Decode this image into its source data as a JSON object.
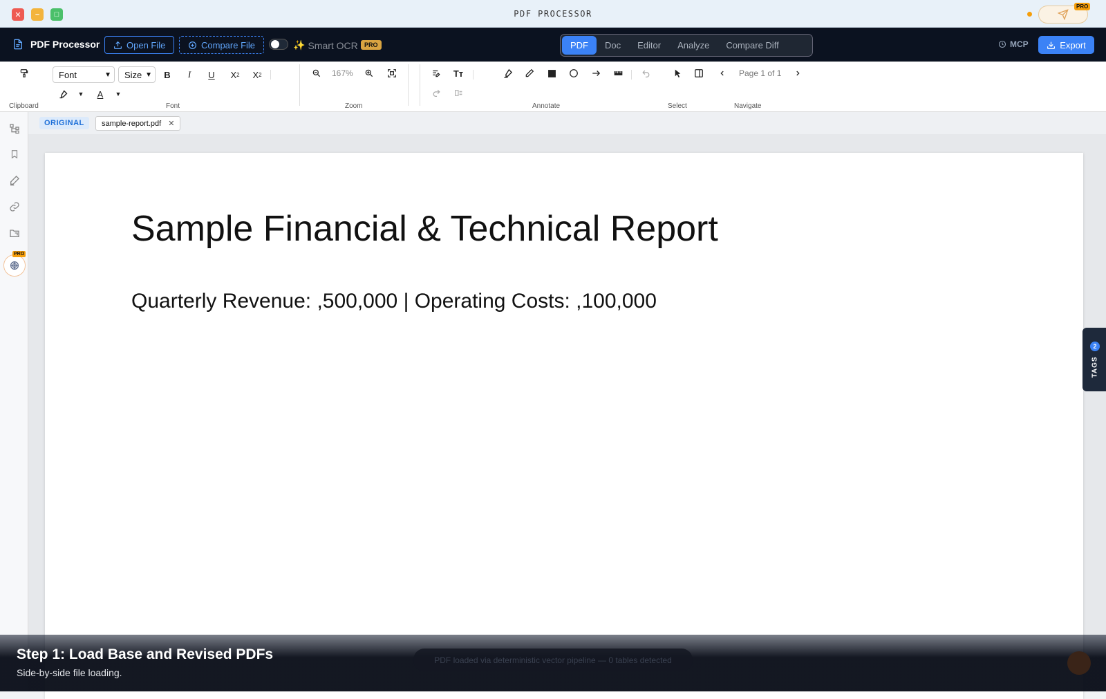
{
  "window": {
    "title": "PDF PROCESSOR",
    "pro_label": "PRO"
  },
  "appbar": {
    "brand": "PDF Processor",
    "open_file": "Open File",
    "compare_file": "Compare File",
    "smart_ocr": "Smart OCR",
    "smart_ocr_badge": "PRO",
    "modes": [
      "PDF",
      "Doc",
      "Editor",
      "Analyze",
      "Compare Diff"
    ],
    "active_mode": "PDF",
    "mcp": "MCP",
    "export": "Export",
    "accent": "#3b82f6"
  },
  "ribbon": {
    "font_select": "Font",
    "size_select": "Size",
    "zoom_value": "167%",
    "page_info": "Page 1 of 1",
    "groups": {
      "clipboard": "Clipboard",
      "font": "Font",
      "zoom": "Zoom",
      "annotate": "Annotate",
      "select": "Select",
      "navigate": "Navigate"
    }
  },
  "sidebar": {
    "items": [
      "structure-icon",
      "bookmark-icon",
      "edit-sign-icon",
      "link-icon",
      "folder-icon"
    ],
    "pro_badge": "PRO"
  },
  "document": {
    "tag": "ORIGINAL",
    "file_tab": "sample-report.pdf",
    "title": "Sample Financial & Technical Report",
    "line": "Quarterly Revenue: ,500,000 | Operating Costs: ,100,000"
  },
  "tags_panel": {
    "label": "TAGS",
    "count": "2"
  },
  "overlay": {
    "step_title": "Step 1: Load Base and Revised PDFs",
    "step_subtitle": "Side-by-side file loading.",
    "toast": "PDF loaded via deterministic vector pipeline — 0 tables detected"
  }
}
